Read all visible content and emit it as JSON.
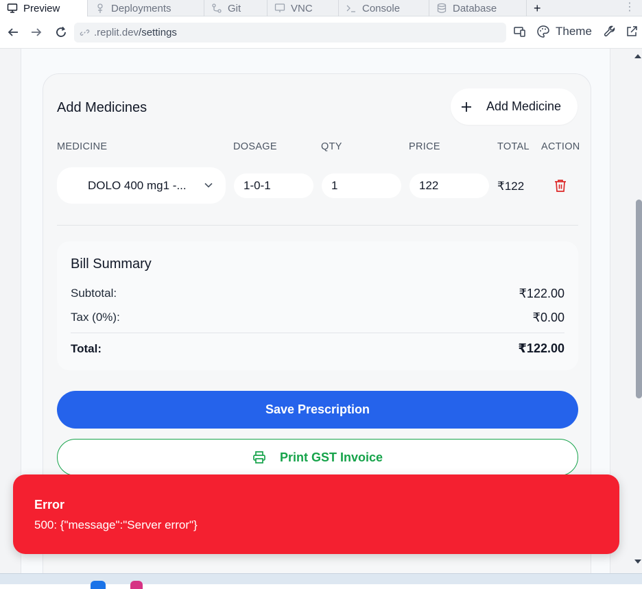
{
  "tabs": [
    {
      "label": "Preview",
      "icon": "monitor-icon",
      "active": true
    },
    {
      "label": "Deployments",
      "icon": "deployments-icon",
      "active": false
    },
    {
      "label": "Git",
      "icon": "git-icon",
      "active": false
    },
    {
      "label": "VNC",
      "icon": "vnc-icon",
      "active": false
    },
    {
      "label": "Console",
      "icon": "console-icon",
      "active": false
    },
    {
      "label": "Database",
      "icon": "database-icon",
      "active": false
    }
  ],
  "new_tab": "+",
  "more": "⋮",
  "address": {
    "host": ".replit.dev",
    "path": "/settings"
  },
  "toolbar": {
    "theme_label": "Theme"
  },
  "medicines": {
    "title": "Add Medicines",
    "add_button": "Add Medicine",
    "columns": [
      "MEDICINE",
      "DOSAGE",
      "QTY",
      "PRICE",
      "TOTAL",
      "ACTION"
    ],
    "rows": [
      {
        "medicine": "DOLO 400 mg1 -...",
        "dosage": "1-0-1",
        "qty": "1",
        "price": "122",
        "total": "₹122"
      }
    ]
  },
  "bill": {
    "title": "Bill Summary",
    "subtotal_label": "Subtotal:",
    "subtotal_value": "₹122.00",
    "tax_label": "Tax (0%):",
    "tax_value": "₹0.00",
    "total_label": "Total:",
    "total_value": "₹122.00"
  },
  "actions": {
    "save_label": "Save Prescription",
    "print_label": "Print GST Invoice"
  },
  "toast": {
    "title": "Error",
    "message": "500: {\"message\":\"Server error\"}"
  },
  "colors": {
    "primary": "#2563eb",
    "success": "#16a34a",
    "danger": "#f42030",
    "delete_icon": "#dc2626"
  }
}
